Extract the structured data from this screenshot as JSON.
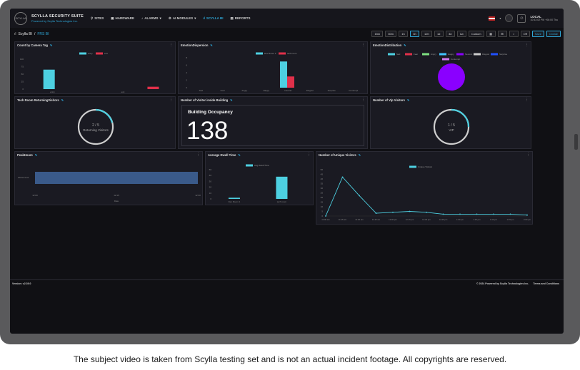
{
  "app": {
    "title": "SCYLLA SECURITY SUITE",
    "subtitle": "Powered by Scylla Technologies Inc.",
    "logo_text": "SCYLLA"
  },
  "nav": {
    "items": [
      {
        "label": "SITES",
        "icon": "pin-icon"
      },
      {
        "label": "HARDWARE",
        "icon": "camera-icon"
      },
      {
        "label": "ALARMS",
        "icon": "bell-icon",
        "has_dropdown": true
      },
      {
        "label": "AI MODULES",
        "icon": "gear-icon",
        "has_dropdown": true
      },
      {
        "label": "SCYLLA BI",
        "icon": "chart-icon",
        "active": true
      },
      {
        "label": "REPORTS",
        "icon": "report-icon"
      }
    ],
    "user": {
      "name": "LOCAL",
      "datetime": "10:43:02 PM +06:00 Thu"
    }
  },
  "breadcrumb": {
    "root": "Scylla BI",
    "current": "FRS BI"
  },
  "time_buttons": [
    "15m",
    "30m",
    "1h",
    "3h",
    "12h",
    "1d",
    "3d",
    "1w",
    "Custom"
  ],
  "selected_time": "3h",
  "toolbar": {
    "off_label": "Off",
    "save_label": "Save",
    "create_label": "Create"
  },
  "panels": {
    "count_by_camera_tag": {
      "title": "Count by Camera Tag",
      "legend": [
        "entry",
        "exit"
      ],
      "yticks": [
        "100",
        "75",
        "50",
        "25",
        "0"
      ],
      "xticks": [
        "entry",
        "exit"
      ]
    },
    "emotion_dispersion": {
      "title": "EmotionDispersion",
      "legend": [
        "Dev Room 1",
        "tech room"
      ],
      "yticks": [
        "8",
        "6",
        "4",
        "2",
        "0"
      ],
      "xticks": [
        "Sad",
        "Fear",
        "Angry",
        "Happy",
        "Neutral",
        "Disgust",
        "Surprise",
        "Contempt"
      ]
    },
    "emotion_distribution": {
      "title": "EmotionDistribution",
      "legend": [
        "Sad",
        "Fear",
        "Angry",
        "Happy",
        "Neutral",
        "Disgust",
        "Surprise",
        "Contempt"
      ]
    },
    "tech_room_returning": {
      "title": "Tech Room ReturningVisitors",
      "value": "2 / 5",
      "label": "Returning Visitors"
    },
    "visitors_inside": {
      "title": "Number of Visitor inside Building",
      "heading": "Building Occupancy",
      "value": "138"
    },
    "vip_visitors": {
      "title": "Number of Vip Visitors",
      "value": "1 / 5",
      "label": "VIP"
    },
    "peak_hours": {
      "title": "PeakHours",
      "ylabel": "2024-01-01",
      "xticks": [
        "12:00",
        "12:15",
        "12:30"
      ],
      "xlabel": "Date"
    },
    "average_dwell": {
      "title": "Average Dwell Time",
      "legend": [
        "Avg Dwell Time"
      ],
      "yticks": [
        "50",
        "40",
        "30",
        "20",
        "10",
        "0"
      ],
      "xticks": [
        "Dev Room 1",
        "tech room"
      ]
    },
    "unique_visitors": {
      "title": "Number of Unique Visitors",
      "legend": [
        "Unique Visitors"
      ],
      "yticks": [
        "50",
        "45",
        "40",
        "35",
        "30",
        "25",
        "20",
        "15",
        "10",
        "5",
        "0"
      ],
      "xticks": [
        "11:00 am",
        "11:15 am",
        "11:30 am",
        "11:45 am",
        "12:00 pm",
        "12:15 pm",
        "12:30 pm",
        "12:45 pm",
        "1:00 pm",
        "1:15 pm",
        "1:30 pm",
        "1:45 pm",
        "2:00 pm"
      ]
    }
  },
  "chart_data": [
    {
      "type": "bar",
      "title": "Count by Camera Tag",
      "categories": [
        "entry",
        "exit"
      ],
      "series": [
        {
          "name": "entry",
          "values": [
            65,
            0
          ]
        },
        {
          "name": "exit",
          "values": [
            0,
            8
          ]
        }
      ],
      "ylim": [
        0,
        100
      ]
    },
    {
      "type": "bar",
      "title": "EmotionDispersion",
      "categories": [
        "Sad",
        "Fear",
        "Angry",
        "Happy",
        "Neutral",
        "Disgust",
        "Surprise",
        "Contempt"
      ],
      "series": [
        {
          "name": "Dev Room 1",
          "values": [
            0,
            0,
            0,
            0,
            7,
            0,
            0,
            0
          ]
        },
        {
          "name": "tech room",
          "values": [
            0,
            0,
            0,
            0,
            3,
            0,
            0,
            0
          ]
        }
      ],
      "ylim": [
        0,
        8
      ]
    },
    {
      "type": "pie",
      "title": "EmotionDistribution",
      "categories": [
        "Sad",
        "Fear",
        "Angry",
        "Happy",
        "Neutral",
        "Disgust",
        "Surprise",
        "Contempt"
      ],
      "values": [
        0,
        0,
        0,
        0,
        100,
        0,
        0,
        0
      ]
    },
    {
      "type": "bar",
      "title": "Average Dwell Time",
      "categories": [
        "Dev Room 1",
        "tech room"
      ],
      "series": [
        {
          "name": "Avg Dwell Time",
          "values": [
            2,
            38
          ]
        }
      ],
      "ylim": [
        0,
        50
      ]
    },
    {
      "type": "line",
      "title": "Number of Unique Visitors",
      "x": [
        "11:00 am",
        "11:15 am",
        "11:30 am",
        "11:45 am",
        "12:00 pm",
        "12:15 pm",
        "12:30 pm",
        "12:45 pm",
        "1:00 pm",
        "1:15 pm",
        "1:30 pm",
        "1:45 pm",
        "2:00 pm"
      ],
      "series": [
        {
          "name": "Unique Visitors",
          "values": [
            0,
            42,
            22,
            3,
            4,
            5,
            4,
            2,
            2,
            2,
            2,
            2,
            1
          ]
        }
      ],
      "ylim": [
        0,
        50
      ]
    }
  ],
  "colors": {
    "accent": "#2ea8d8",
    "cyan": "#4dd0e1",
    "red": "#e0304a",
    "purple": "#8a00ff",
    "peak_bar": "#3a5a8a",
    "emotion": [
      "#4dd0e1",
      "#e0304a",
      "#7ee081",
      "#40c4ff",
      "#8a00ff",
      "#cccccc",
      "#2050ff",
      "#d07af0"
    ]
  },
  "footer": {
    "version": "Version: v2.39.0",
    "copyright": "© 2024 Powered by Scylla Technologies Inc.",
    "terms": "Terms and Conditions"
  },
  "caption": "The subject video is taken from Scylla testing set and is not an actual incident footage. All copyrights are reserved."
}
